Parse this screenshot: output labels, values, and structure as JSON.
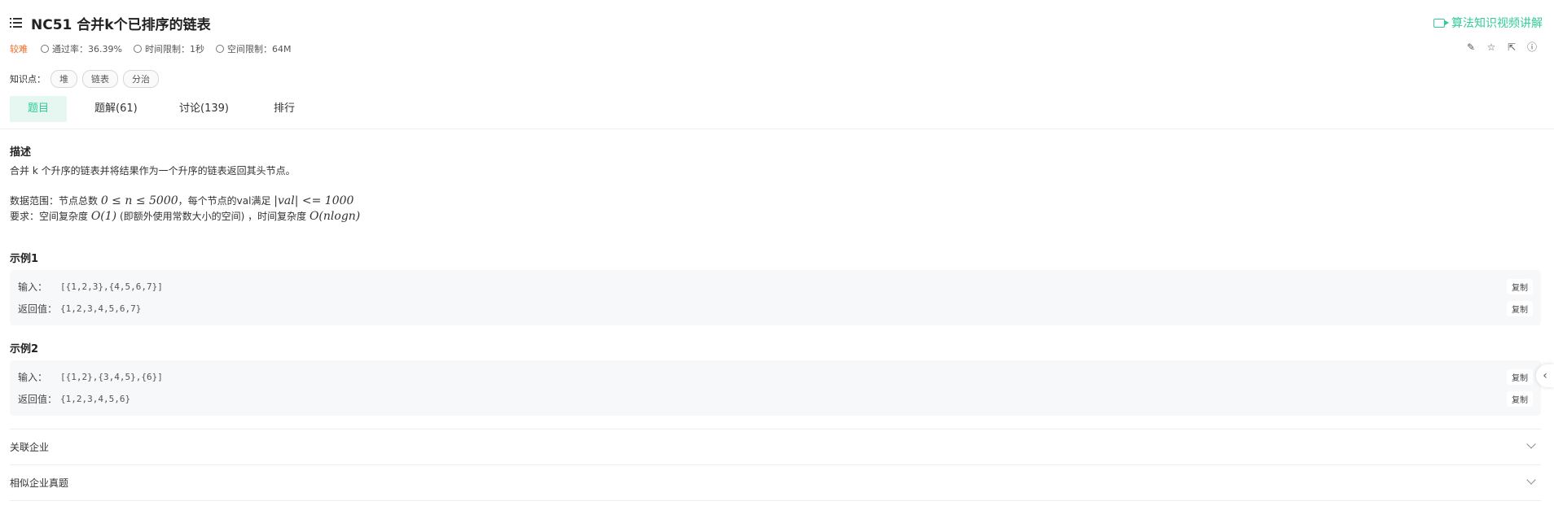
{
  "header": {
    "title": "NC51  合并k个已排序的链表",
    "video_link": "算法知识视频讲解"
  },
  "meta": {
    "difficulty": "较难",
    "pass_rate": "通过率：36.39%",
    "time_limit": "时间限制：1秒",
    "space_limit": "空间限制：64M"
  },
  "tags": {
    "label": "知识点：",
    "items": [
      "堆",
      "链表",
      "分治"
    ]
  },
  "tabs": [
    "题目",
    "题解(61)",
    "讨论(139)",
    "排行"
  ],
  "description": {
    "title": "描述",
    "line1": "合并 k 个升序的链表并将结果作为一个升序的链表返回其头节点。",
    "range_prefix": "数据范围：节点总数 ",
    "range_math": "0 ≤ n ≤ 5000",
    "range_mid": "，每个节点的val满足 ",
    "range_math2": "|val| <= 1000",
    "req_prefix": "要求：空间复杂度 ",
    "req_math1": "O(1)",
    "req_mid": " (即额外使用常数大小的空间) ，时间复杂度 ",
    "req_math2": "O(nlogn)"
  },
  "examples": [
    {
      "title": "示例1",
      "input_label": "输入：",
      "input_value": "[{1,2,3},{4,5,6,7}]",
      "output_label": "返回值：",
      "output_value": "{1,2,3,4,5,6,7}",
      "copy": "复制"
    },
    {
      "title": "示例2",
      "input_label": "输入：",
      "input_value": "[{1,2},{3,4,5},{6}]",
      "output_label": "返回值：",
      "output_value": "{1,2,3,4,5,6}",
      "copy": "复制"
    }
  ],
  "accordions": [
    "关联企业",
    "相似企业真题"
  ],
  "colors": {
    "accent": "#32ca99",
    "difficulty": "#f06a25"
  }
}
